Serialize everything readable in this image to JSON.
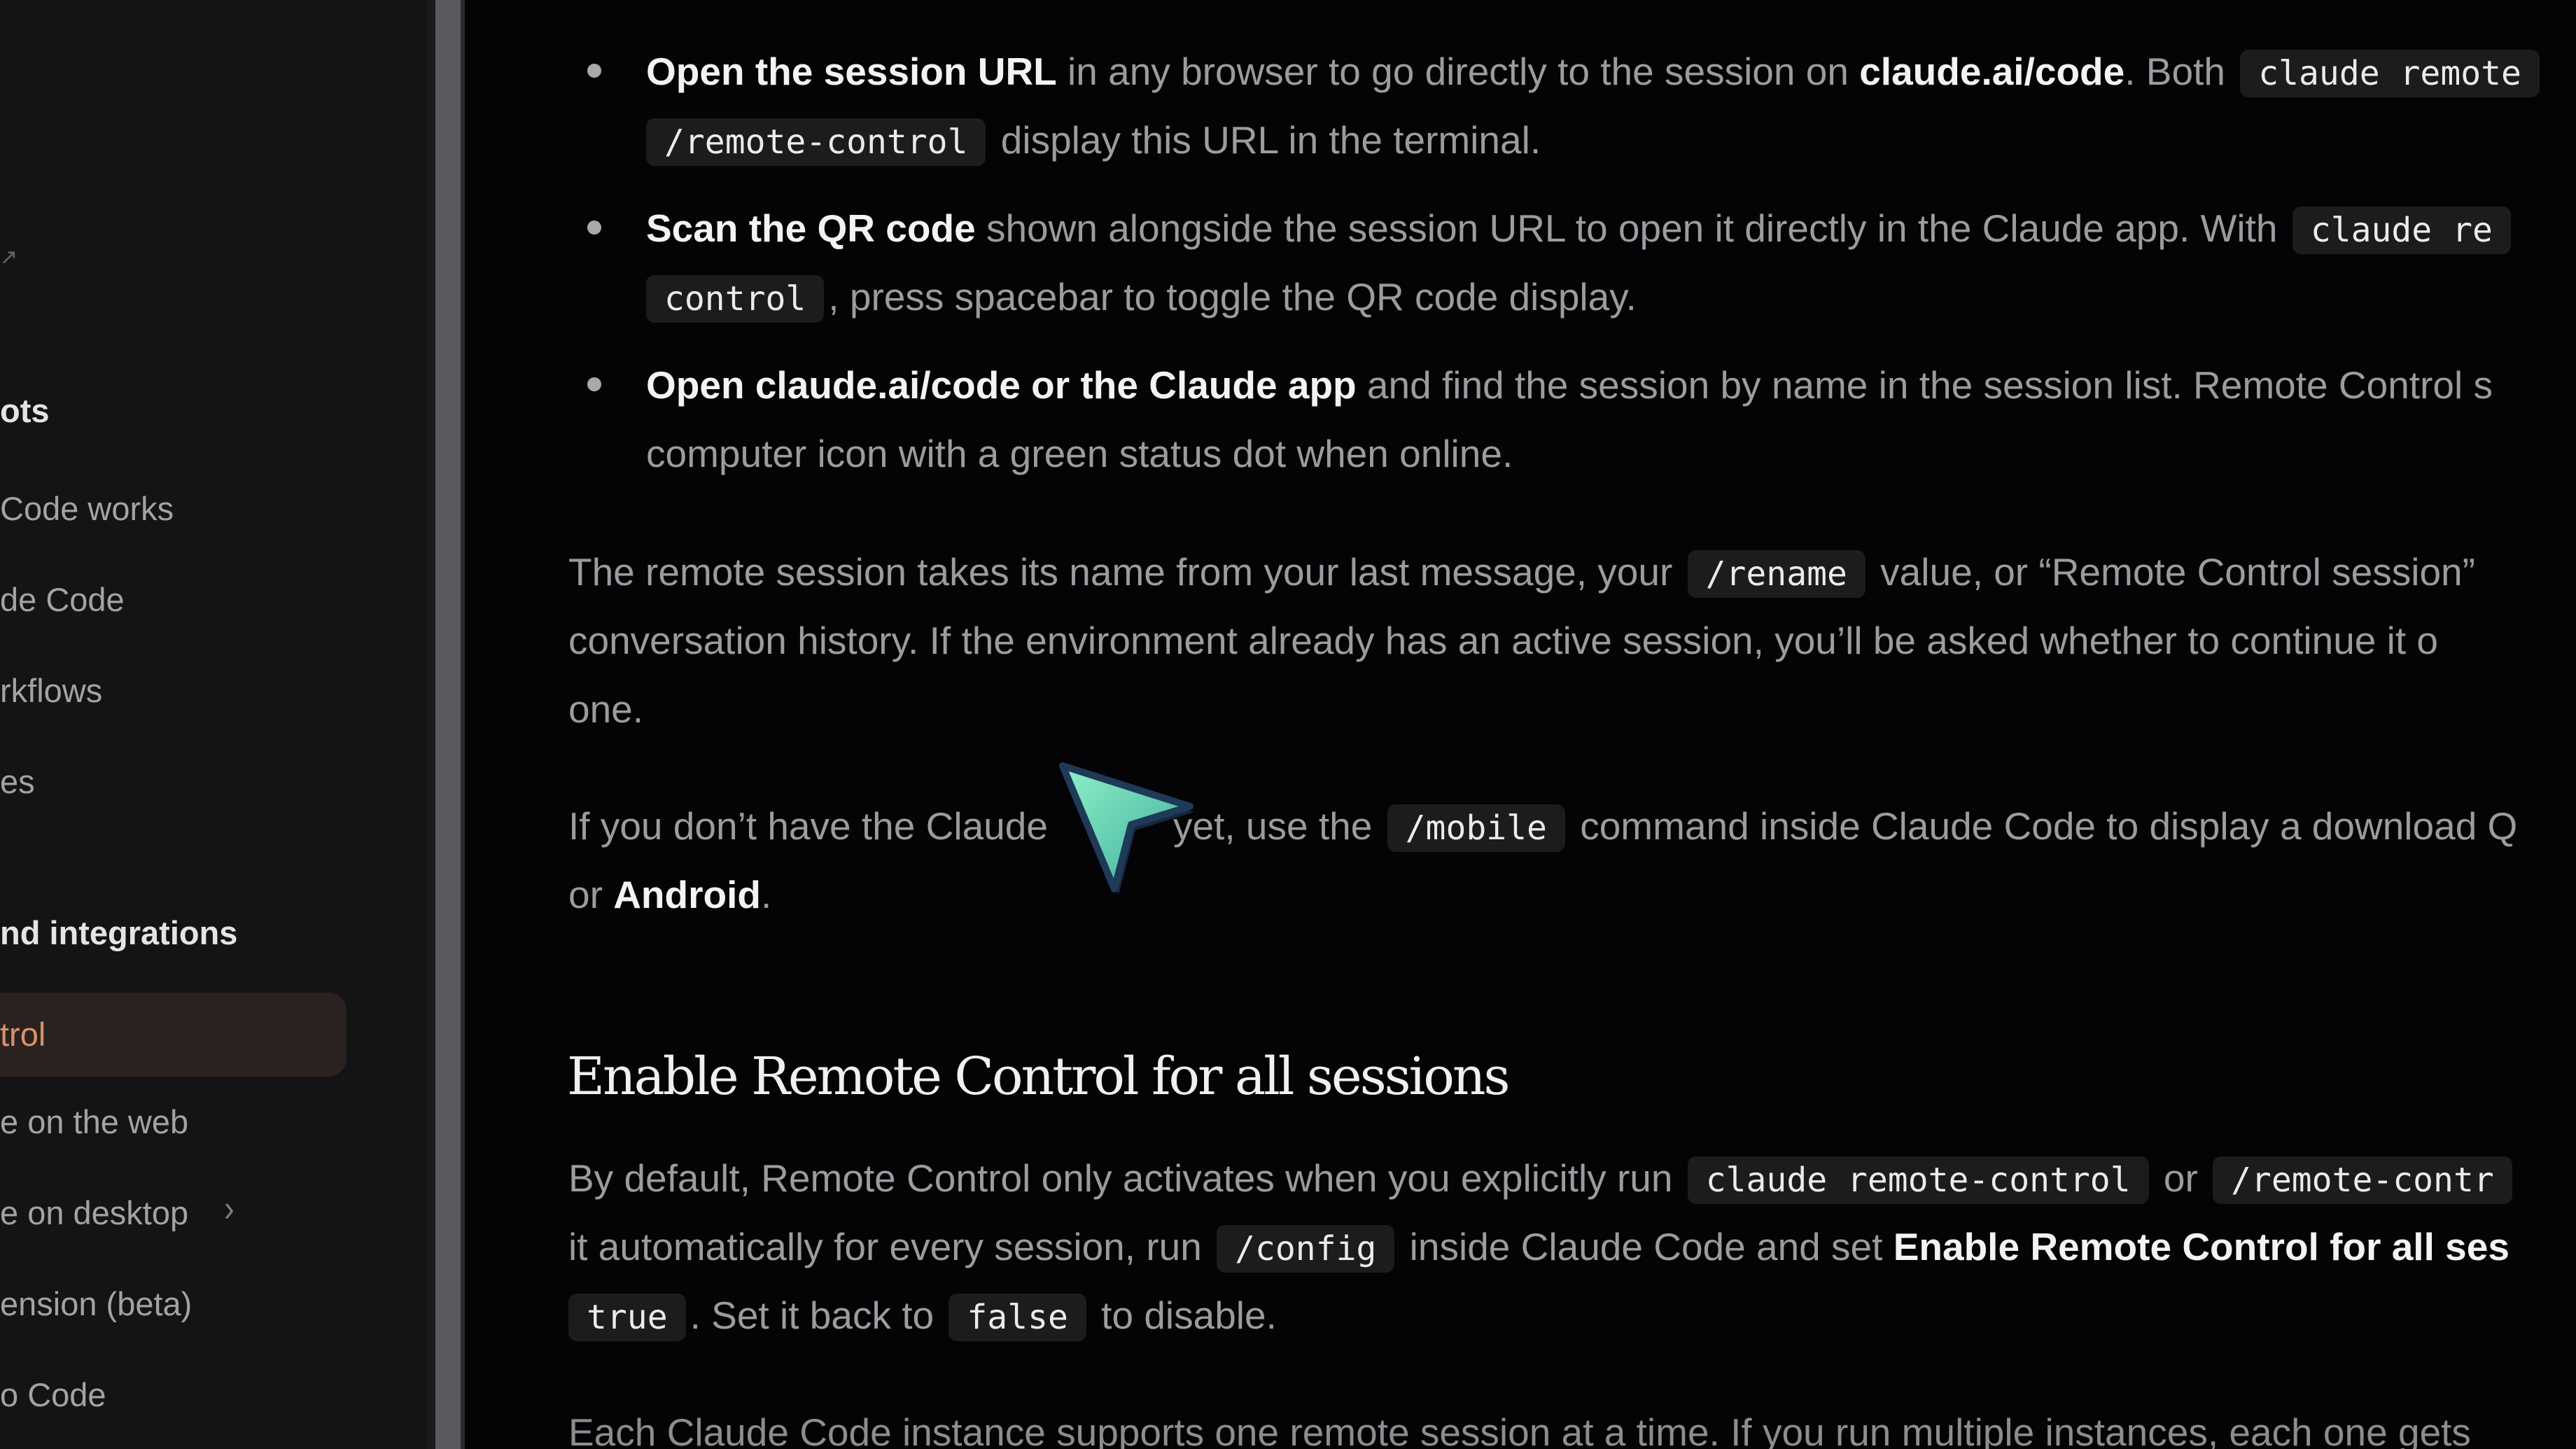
{
  "sidebar": {
    "items": [
      {
        "label": "ots",
        "kind": "section"
      },
      {
        "label": "Code works",
        "kind": "link"
      },
      {
        "label": "de Code",
        "kind": "link"
      },
      {
        "label": "rkflows",
        "kind": "link"
      },
      {
        "label": "es",
        "kind": "link"
      },
      {
        "label": "nd integrations",
        "kind": "section"
      },
      {
        "label": "trol",
        "kind": "active"
      },
      {
        "label": "e on the web",
        "kind": "link"
      },
      {
        "label": "e on desktop",
        "kind": "link"
      },
      {
        "label": "ension (beta)",
        "kind": "link"
      },
      {
        "label": "o Code",
        "kind": "link"
      }
    ],
    "icons": {
      "expand": "chevron-right-icon",
      "external": "external-link-icon"
    }
  },
  "content": {
    "b1": {
      "bold": "Open the session URL",
      "t1": " in any browser to go directly to the session on ",
      "bold2": "claude.ai/code",
      "t2": ". Both ",
      "code1": "claude remote",
      "code2": "/remote-control",
      "t3": " display this URL in the terminal."
    },
    "b2": {
      "bold": "Scan the QR code",
      "t1": " shown alongside the session URL to open it directly in the Claude app. With ",
      "code1": "claude re",
      "code2": "control",
      "t2": ", press spacebar to toggle the QR code display."
    },
    "b3": {
      "bold": "Open claude.ai/code or the Claude app",
      "t1": " and find the session by name in the session list. Remote Control s",
      "t2": "computer icon with a green status dot when online."
    },
    "p1": {
      "t1": "The remote session takes its name from your last message, your ",
      "code": "/rename",
      "t2": " value, or “Remote Control session”",
      "line2": "conversation history. If the environment already has an active session, you’ll be asked whether to continue it o",
      "line3": "one."
    },
    "p2": {
      "t1": "If you don’t have the Claude",
      "t2": "yet, use the ",
      "code": "/mobile",
      "t3": " command inside Claude Code to display a download Q",
      "t4": "or ",
      "bold": "Android",
      "t5": "."
    },
    "heading": "Enable Remote Control for all sessions",
    "p3": {
      "t1": "By default, Remote Control only activates when you explicitly run ",
      "code1": "claude remote-control",
      "t2": " or ",
      "code2": "/remote-contr",
      "t3": "it automatically for every session, run ",
      "code3": "/config",
      "t4": " inside Claude Code and set ",
      "bold": "Enable Remote Control for all ses",
      "code4": "true",
      "t5": ". Set it back to ",
      "code5": "false",
      "t6": " to disable."
    },
    "p4": "Each Claude Code instance supports one remote session at a time. If you run multiple instances, each one gets"
  },
  "cursor": {
    "icon": "pointer-cursor-icon",
    "colors": {
      "fill": "#6fd8b4",
      "edge": "#1f3a57"
    }
  }
}
